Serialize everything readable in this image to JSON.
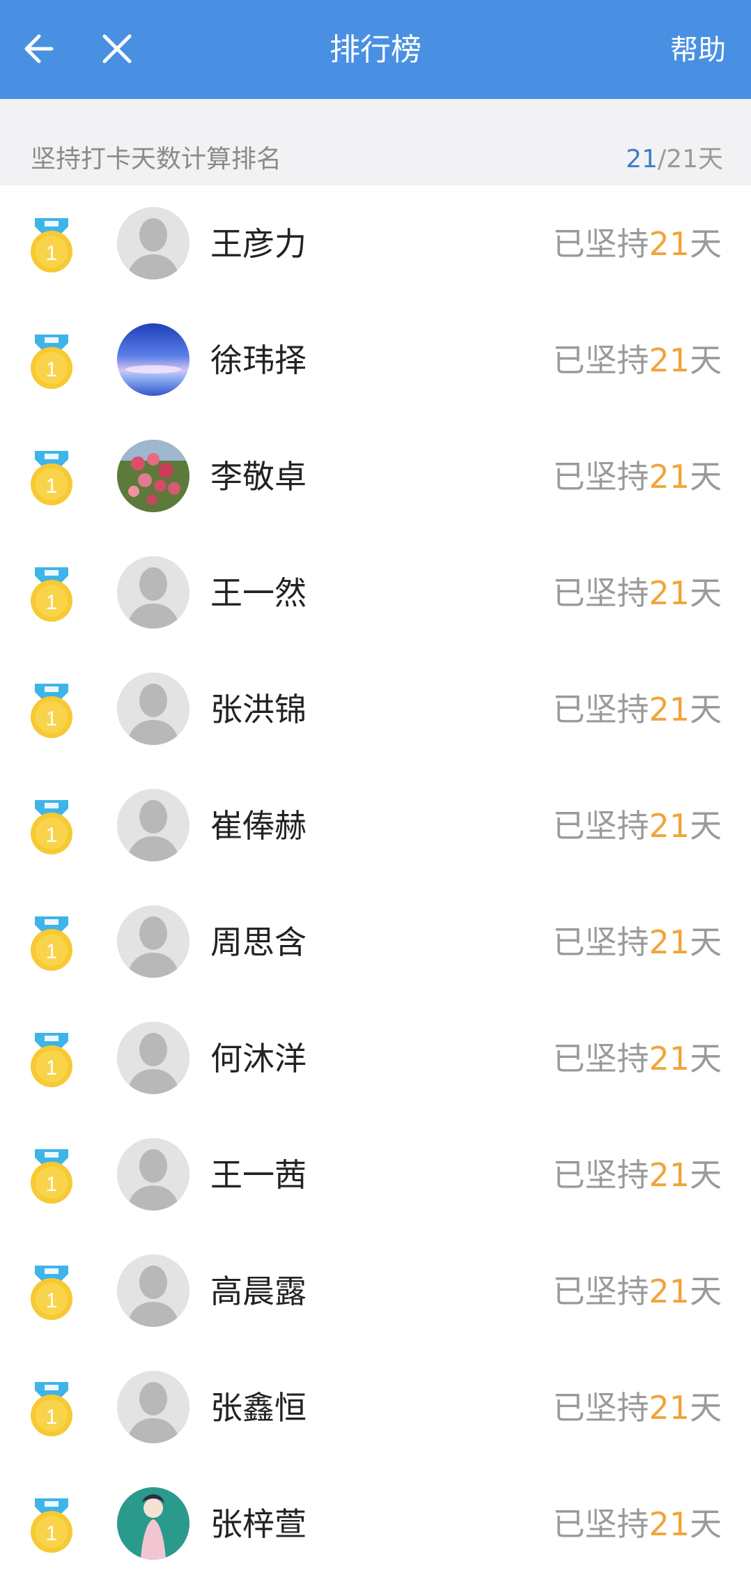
{
  "header": {
    "title": "排行榜",
    "help_label": "帮助",
    "back_icon": "arrow-left-icon",
    "close_icon": "close-icon",
    "background_color": "#4a90e2"
  },
  "subheader": {
    "label": "坚持打卡天数计算排名",
    "count_current": "21",
    "count_total": "/21天"
  },
  "ranking": [
    {
      "rank": "1",
      "name": "王彦力",
      "prefix": "已坚持",
      "days": "21",
      "suffix": "天",
      "avatar": "default"
    },
    {
      "rank": "1",
      "name": "徐玮择",
      "prefix": "已坚持",
      "days": "21",
      "suffix": "天",
      "avatar": "sky"
    },
    {
      "rank": "1",
      "name": "李敬卓",
      "prefix": "已坚持",
      "days": "21",
      "suffix": "天",
      "avatar": "flowers"
    },
    {
      "rank": "1",
      "name": "王一然",
      "prefix": "已坚持",
      "days": "21",
      "suffix": "天",
      "avatar": "default"
    },
    {
      "rank": "1",
      "name": "张洪锦",
      "prefix": "已坚持",
      "days": "21",
      "suffix": "天",
      "avatar": "default"
    },
    {
      "rank": "1",
      "name": "崔俸赫",
      "prefix": "已坚持",
      "days": "21",
      "suffix": "天",
      "avatar": "default"
    },
    {
      "rank": "1",
      "name": "周思含",
      "prefix": "已坚持",
      "days": "21",
      "suffix": "天",
      "avatar": "default"
    },
    {
      "rank": "1",
      "name": "何沐洋",
      "prefix": "已坚持",
      "days": "21",
      "suffix": "天",
      "avatar": "default"
    },
    {
      "rank": "1",
      "name": "王一茜",
      "prefix": "已坚持",
      "days": "21",
      "suffix": "天",
      "avatar": "default"
    },
    {
      "rank": "1",
      "name": "高晨露",
      "prefix": "已坚持",
      "days": "21",
      "suffix": "天",
      "avatar": "default"
    },
    {
      "rank": "1",
      "name": "张鑫恒",
      "prefix": "已坚持",
      "days": "21",
      "suffix": "天",
      "avatar": "default"
    },
    {
      "rank": "1",
      "name": "张梓萱",
      "prefix": "已坚持",
      "days": "21",
      "suffix": "天",
      "avatar": "illustration"
    }
  ]
}
